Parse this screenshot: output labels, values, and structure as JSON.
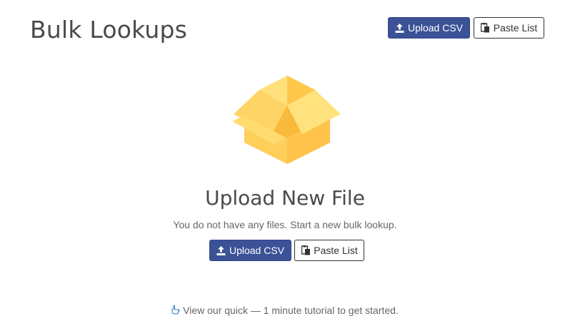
{
  "header": {
    "title": "Bulk Lookups",
    "upload_label": "Upload CSV",
    "paste_label": "Paste List"
  },
  "empty_state": {
    "illustration_icon": "open-box-icon",
    "title": "Upload New File",
    "subtitle": "You do not have any files. Start a new bulk lookup.",
    "upload_label": "Upload CSV",
    "paste_label": "Paste List"
  },
  "tutorial": {
    "icon": "pointing-hand-icon",
    "text": "View our quick — 1 minute tutorial to get started."
  },
  "colors": {
    "primary": "#3b5297",
    "box_light": "#ffd466",
    "box_dark": "#ffc24a"
  }
}
